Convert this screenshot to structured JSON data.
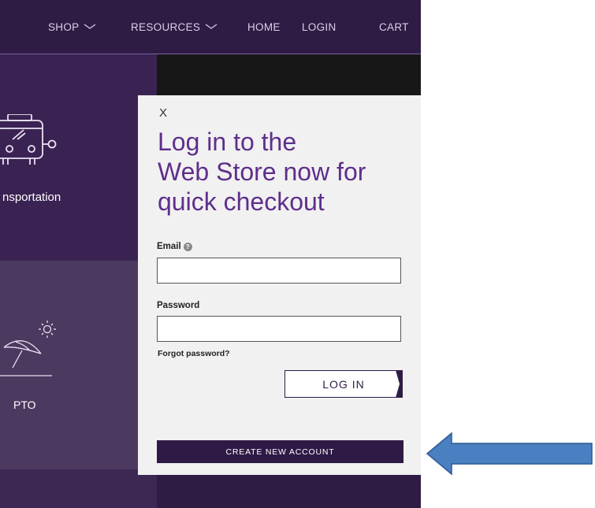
{
  "nav": {
    "shop": "SHOP",
    "resources": "RESOURCES",
    "home": "HOME",
    "login": "LOGIN",
    "cart": "CART"
  },
  "tiles": {
    "transportation": "nsportation",
    "pto": "PTO"
  },
  "modal": {
    "close": "X",
    "headline_line1": "Log in to the",
    "headline_line2": "Web Store now for",
    "headline_line3": "quick checkout",
    "email_label": "Email",
    "help_glyph": "?",
    "email_value": "",
    "password_label": "Password",
    "password_value": "",
    "forgot": "Forgot password?",
    "login": "LOG IN",
    "create": "CREATE NEW ACCOUNT"
  },
  "colors": {
    "brand_purple": "#2f1c45",
    "headline_purple": "#5e2f8c",
    "arrow_blue": "#4a7fc1"
  },
  "icons": [
    "bus-icon",
    "beach-umbrella-icon",
    "chevron-down-icon",
    "help-icon",
    "left-arrow-icon"
  ]
}
